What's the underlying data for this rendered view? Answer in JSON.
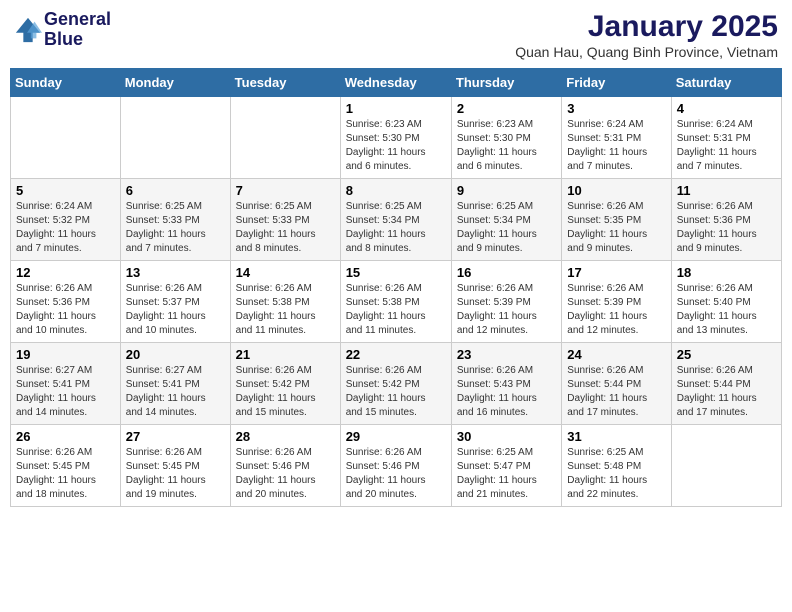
{
  "header": {
    "logo_line1": "General",
    "logo_line2": "Blue",
    "month": "January 2025",
    "location": "Quan Hau, Quang Binh Province, Vietnam"
  },
  "days_of_week": [
    "Sunday",
    "Monday",
    "Tuesday",
    "Wednesday",
    "Thursday",
    "Friday",
    "Saturday"
  ],
  "weeks": [
    [
      {
        "day": "",
        "text": ""
      },
      {
        "day": "",
        "text": ""
      },
      {
        "day": "",
        "text": ""
      },
      {
        "day": "1",
        "text": "Sunrise: 6:23 AM\nSunset: 5:30 PM\nDaylight: 11 hours\nand 6 minutes."
      },
      {
        "day": "2",
        "text": "Sunrise: 6:23 AM\nSunset: 5:30 PM\nDaylight: 11 hours\nand 6 minutes."
      },
      {
        "day": "3",
        "text": "Sunrise: 6:24 AM\nSunset: 5:31 PM\nDaylight: 11 hours\nand 7 minutes."
      },
      {
        "day": "4",
        "text": "Sunrise: 6:24 AM\nSunset: 5:31 PM\nDaylight: 11 hours\nand 7 minutes."
      }
    ],
    [
      {
        "day": "5",
        "text": "Sunrise: 6:24 AM\nSunset: 5:32 PM\nDaylight: 11 hours\nand 7 minutes."
      },
      {
        "day": "6",
        "text": "Sunrise: 6:25 AM\nSunset: 5:33 PM\nDaylight: 11 hours\nand 7 minutes."
      },
      {
        "day": "7",
        "text": "Sunrise: 6:25 AM\nSunset: 5:33 PM\nDaylight: 11 hours\nand 8 minutes."
      },
      {
        "day": "8",
        "text": "Sunrise: 6:25 AM\nSunset: 5:34 PM\nDaylight: 11 hours\nand 8 minutes."
      },
      {
        "day": "9",
        "text": "Sunrise: 6:25 AM\nSunset: 5:34 PM\nDaylight: 11 hours\nand 9 minutes."
      },
      {
        "day": "10",
        "text": "Sunrise: 6:26 AM\nSunset: 5:35 PM\nDaylight: 11 hours\nand 9 minutes."
      },
      {
        "day": "11",
        "text": "Sunrise: 6:26 AM\nSunset: 5:36 PM\nDaylight: 11 hours\nand 9 minutes."
      }
    ],
    [
      {
        "day": "12",
        "text": "Sunrise: 6:26 AM\nSunset: 5:36 PM\nDaylight: 11 hours\nand 10 minutes."
      },
      {
        "day": "13",
        "text": "Sunrise: 6:26 AM\nSunset: 5:37 PM\nDaylight: 11 hours\nand 10 minutes."
      },
      {
        "day": "14",
        "text": "Sunrise: 6:26 AM\nSunset: 5:38 PM\nDaylight: 11 hours\nand 11 minutes."
      },
      {
        "day": "15",
        "text": "Sunrise: 6:26 AM\nSunset: 5:38 PM\nDaylight: 11 hours\nand 11 minutes."
      },
      {
        "day": "16",
        "text": "Sunrise: 6:26 AM\nSunset: 5:39 PM\nDaylight: 11 hours\nand 12 minutes."
      },
      {
        "day": "17",
        "text": "Sunrise: 6:26 AM\nSunset: 5:39 PM\nDaylight: 11 hours\nand 12 minutes."
      },
      {
        "day": "18",
        "text": "Sunrise: 6:26 AM\nSunset: 5:40 PM\nDaylight: 11 hours\nand 13 minutes."
      }
    ],
    [
      {
        "day": "19",
        "text": "Sunrise: 6:27 AM\nSunset: 5:41 PM\nDaylight: 11 hours\nand 14 minutes."
      },
      {
        "day": "20",
        "text": "Sunrise: 6:27 AM\nSunset: 5:41 PM\nDaylight: 11 hours\nand 14 minutes."
      },
      {
        "day": "21",
        "text": "Sunrise: 6:26 AM\nSunset: 5:42 PM\nDaylight: 11 hours\nand 15 minutes."
      },
      {
        "day": "22",
        "text": "Sunrise: 6:26 AM\nSunset: 5:42 PM\nDaylight: 11 hours\nand 15 minutes."
      },
      {
        "day": "23",
        "text": "Sunrise: 6:26 AM\nSunset: 5:43 PM\nDaylight: 11 hours\nand 16 minutes."
      },
      {
        "day": "24",
        "text": "Sunrise: 6:26 AM\nSunset: 5:44 PM\nDaylight: 11 hours\nand 17 minutes."
      },
      {
        "day": "25",
        "text": "Sunrise: 6:26 AM\nSunset: 5:44 PM\nDaylight: 11 hours\nand 17 minutes."
      }
    ],
    [
      {
        "day": "26",
        "text": "Sunrise: 6:26 AM\nSunset: 5:45 PM\nDaylight: 11 hours\nand 18 minutes."
      },
      {
        "day": "27",
        "text": "Sunrise: 6:26 AM\nSunset: 5:45 PM\nDaylight: 11 hours\nand 19 minutes."
      },
      {
        "day": "28",
        "text": "Sunrise: 6:26 AM\nSunset: 5:46 PM\nDaylight: 11 hours\nand 20 minutes."
      },
      {
        "day": "29",
        "text": "Sunrise: 6:26 AM\nSunset: 5:46 PM\nDaylight: 11 hours\nand 20 minutes."
      },
      {
        "day": "30",
        "text": "Sunrise: 6:25 AM\nSunset: 5:47 PM\nDaylight: 11 hours\nand 21 minutes."
      },
      {
        "day": "31",
        "text": "Sunrise: 6:25 AM\nSunset: 5:48 PM\nDaylight: 11 hours\nand 22 minutes."
      },
      {
        "day": "",
        "text": ""
      }
    ]
  ]
}
